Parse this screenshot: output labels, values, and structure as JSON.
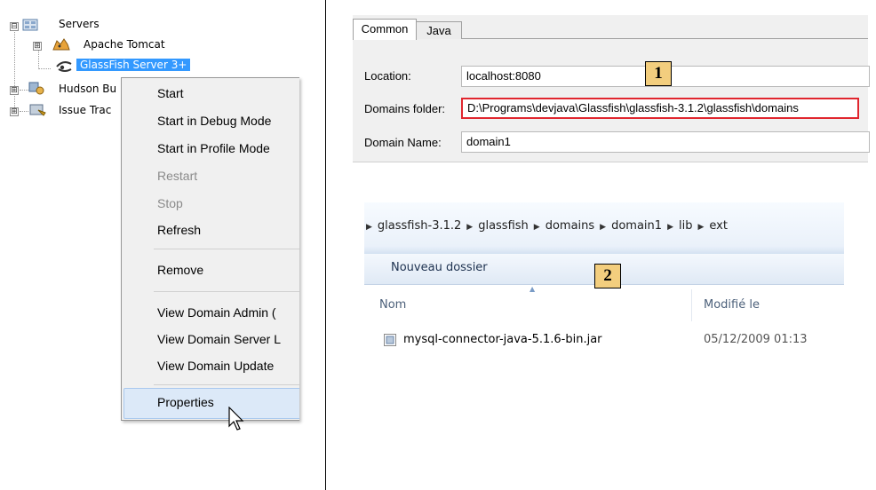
{
  "tree": {
    "root": {
      "label": "Servers",
      "expander": "⊟"
    },
    "children": [
      {
        "label": "Apache Tomcat",
        "expander": "⊞"
      },
      {
        "label": "GlassFish Server 3+",
        "selected": true
      }
    ],
    "siblings": [
      {
        "label": "Hudson Bu",
        "expander": "⊞"
      },
      {
        "label": "Issue Trac",
        "expander": "⊞"
      }
    ]
  },
  "context_menu": {
    "groups": [
      [
        {
          "label": "Start",
          "disabled": false
        },
        {
          "label": "Start in Debug Mode",
          "disabled": false
        },
        {
          "label": "Start in Profile Mode",
          "disabled": false
        },
        {
          "label": "Restart",
          "disabled": true
        },
        {
          "label": "Stop",
          "disabled": true
        },
        {
          "label": "Refresh",
          "disabled": false
        }
      ],
      [
        {
          "label": "Remove",
          "disabled": false
        }
      ],
      [
        {
          "label": "View Domain Admin (",
          "disabled": false
        },
        {
          "label": "View Domain Server L",
          "disabled": false
        },
        {
          "label": "View Domain Update",
          "disabled": false
        }
      ],
      [
        {
          "label": "Properties",
          "disabled": false,
          "hovered": true
        }
      ]
    ]
  },
  "properties": {
    "tabs": [
      {
        "label": "Common",
        "active": true
      },
      {
        "label": "Java",
        "active": false
      }
    ],
    "fields": [
      {
        "label": "Location:",
        "value": "localhost:8080"
      },
      {
        "label": "Domains folder:",
        "value": "D:\\Programs\\devjava\\Glassfish\\glassfish-3.1.2\\glassfish\\domains",
        "highlighted": true
      },
      {
        "label": "Domain Name:",
        "value": "domain1"
      }
    ],
    "badge": "1"
  },
  "explorer": {
    "breadcrumb": [
      "glassfish-3.1.2",
      "glassfish",
      "domains",
      "domain1",
      "lib",
      "ext"
    ],
    "toolbar_button": "Nouveau dossier",
    "badge": "2",
    "columns": {
      "name": "Nom",
      "modified": "Modifié le"
    },
    "files": [
      {
        "name": "mysql-connector-java-5.1.6-bin.jar",
        "modified": "05/12/2009 01:13"
      }
    ]
  },
  "colors": {
    "selection": "#3399ff",
    "badge_fill": "#f3ce7e",
    "highlight_border": "#e0262e",
    "menu_hover": "#dce9f8"
  }
}
